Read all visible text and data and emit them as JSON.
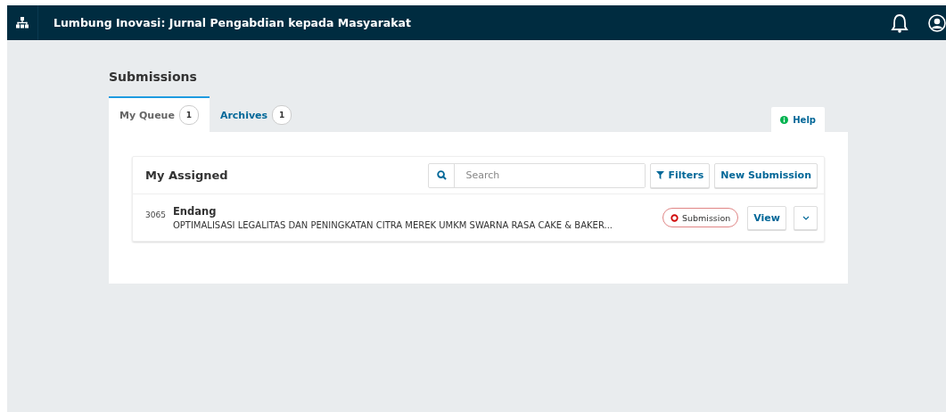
{
  "header": {
    "title": "Lumbung Inovasi: Jurnal Pengabdian kepada Masyarakat"
  },
  "page_title": "Submissions",
  "tabs": [
    {
      "label": "My Queue",
      "count": "1",
      "selected": true
    },
    {
      "label": "Archives",
      "count": "1",
      "selected": false
    }
  ],
  "help": "Help",
  "list": {
    "title": "My Assigned",
    "search": {
      "placeholder": "Search"
    },
    "filters": "Filters",
    "new_button": "New Submission",
    "items": [
      {
        "id": "3065",
        "author": "Endang",
        "title": "OPTIMALISASI LEGALITAS DAN PENINGKATAN CITRA MEREK UMKM SWARNA RASA CAKE & BAKER...",
        "stage": "Submission",
        "action": "View"
      }
    ]
  }
}
